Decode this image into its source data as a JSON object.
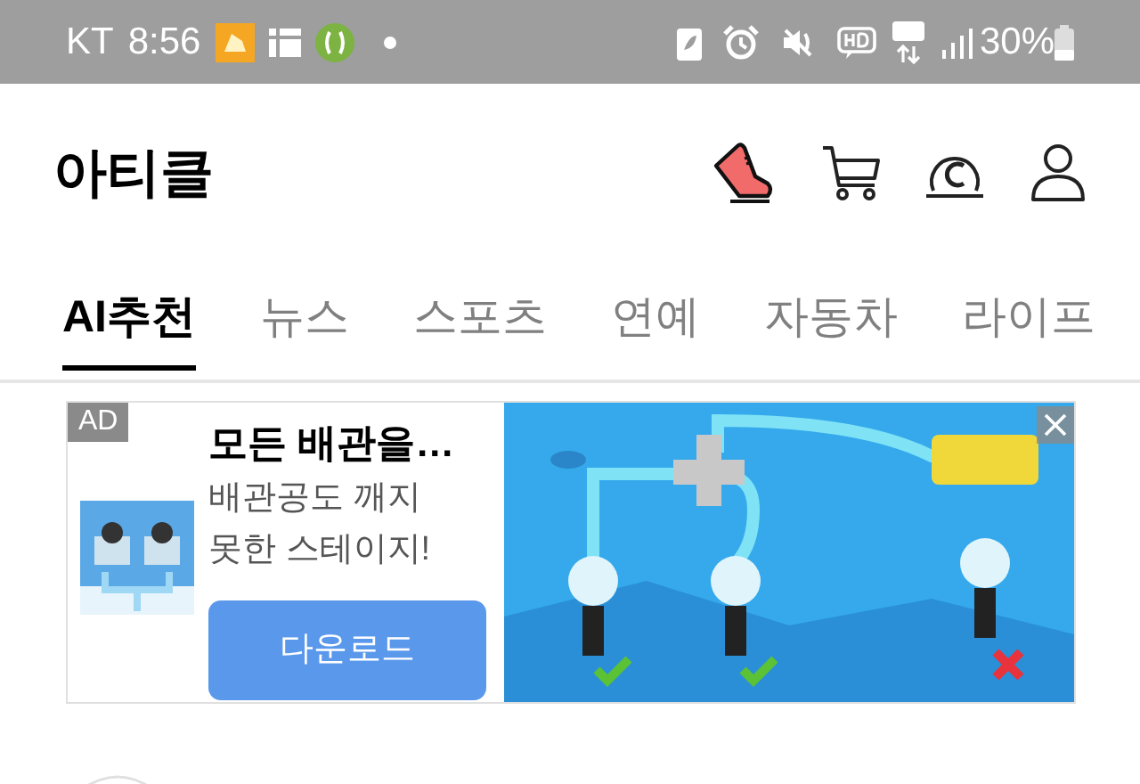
{
  "status_bar": {
    "carrier": "KT",
    "time": "8:56",
    "battery_text": "30%"
  },
  "header": {
    "title": "아티클"
  },
  "tabs": [
    {
      "label": "AI추천",
      "selected": true
    },
    {
      "label": "뉴스",
      "selected": false
    },
    {
      "label": "스포츠",
      "selected": false
    },
    {
      "label": "연예",
      "selected": false
    },
    {
      "label": "자동차",
      "selected": false
    },
    {
      "label": "라이프",
      "selected": false
    }
  ],
  "ad": {
    "badge": "AD",
    "title": "모든 배관을…",
    "description": "배관공도 깨지 못한 스테이지!",
    "button": "다운로드"
  }
}
